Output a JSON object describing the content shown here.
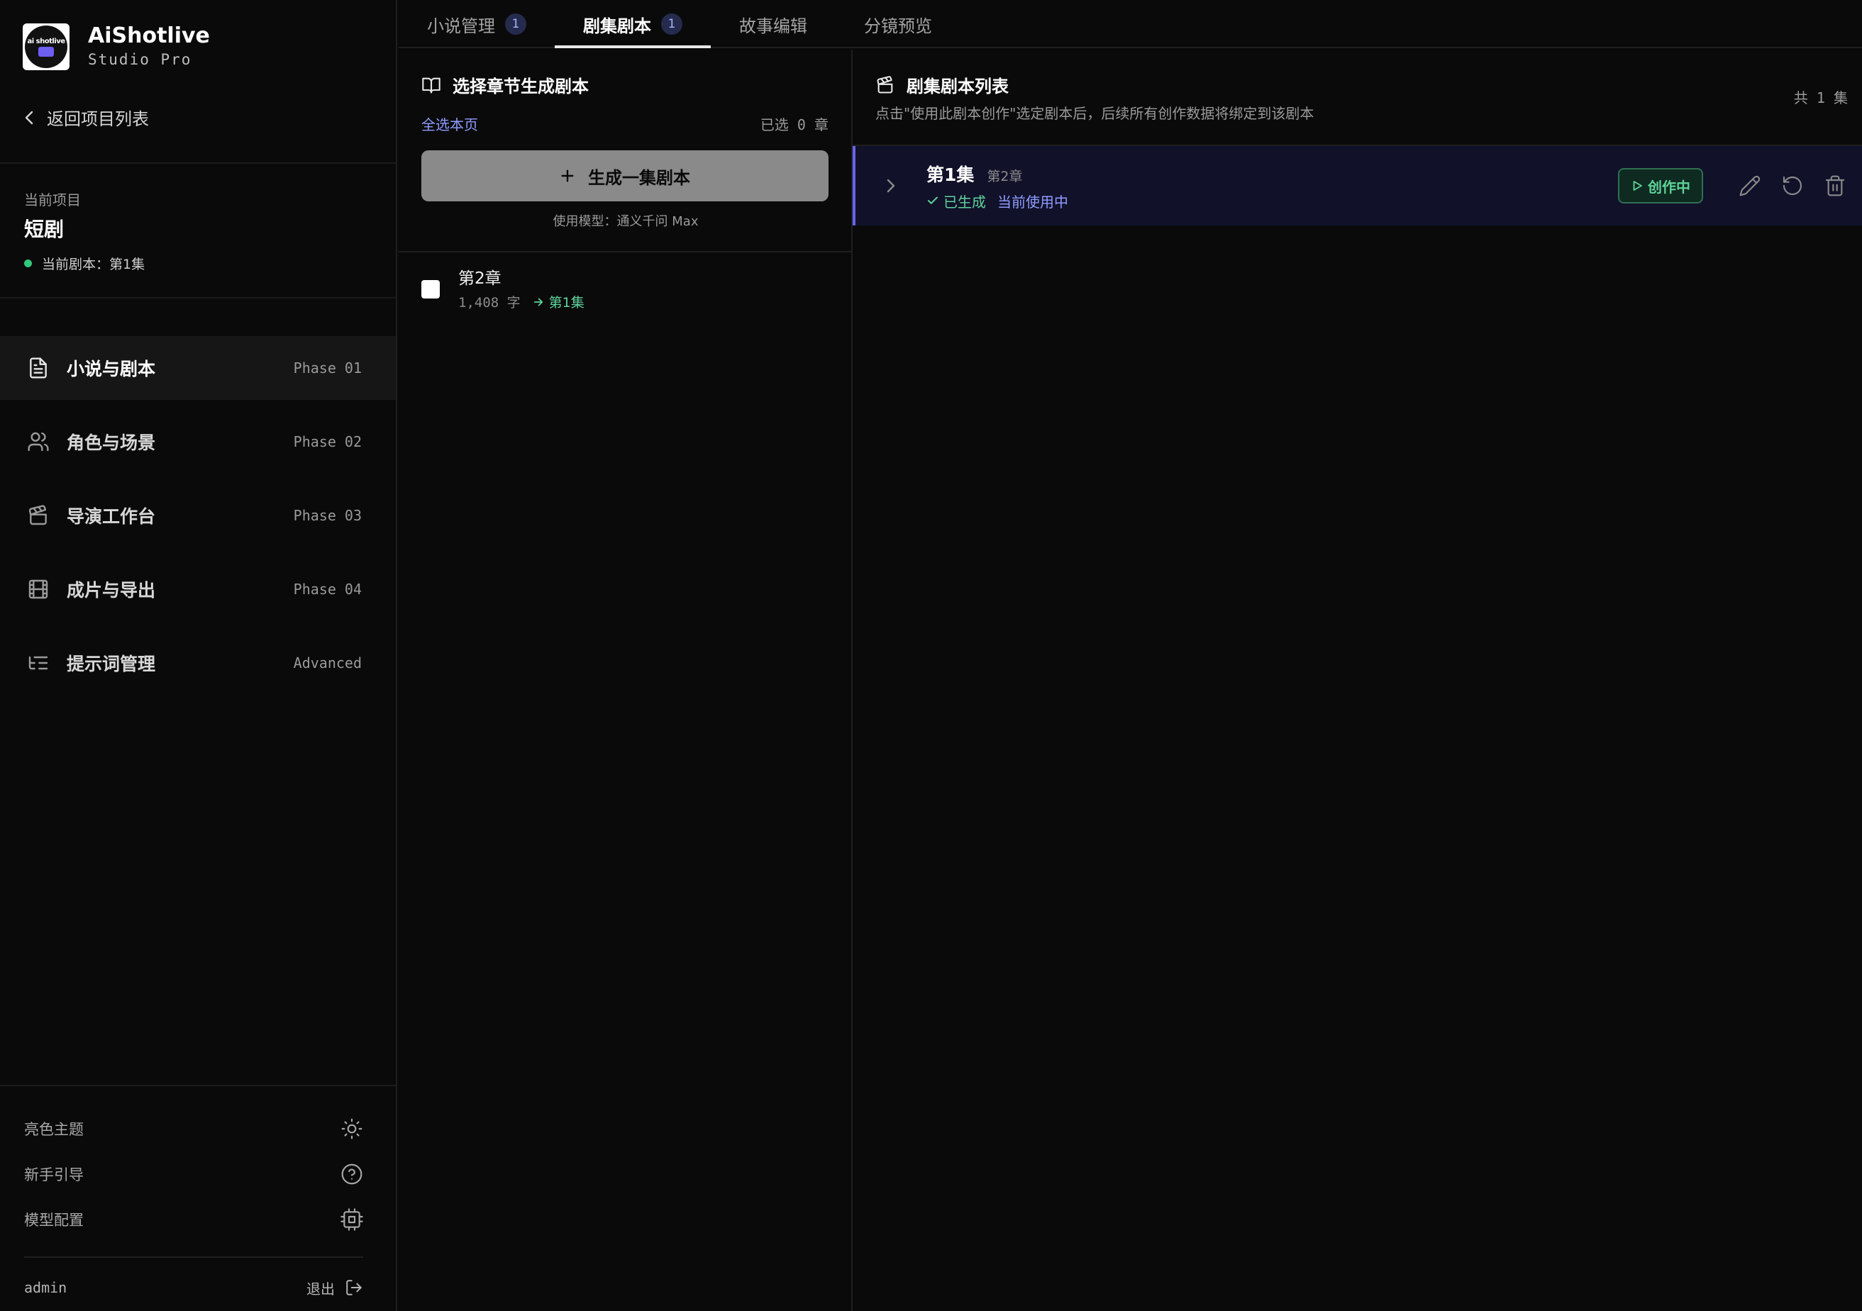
{
  "brand": {
    "name": "AiShotlive",
    "subtitle": "Studio Pro",
    "logo_text": "ai shotlive"
  },
  "sidebar": {
    "back_label": "返回项目列表",
    "project_label": "当前项目",
    "project_name": "短剧",
    "current_script": "当前剧本：第1集",
    "nav": [
      {
        "label": "小说与剧本",
        "phase": "Phase 01",
        "icon": "document-icon",
        "active": true
      },
      {
        "label": "角色与场景",
        "phase": "Phase 02",
        "icon": "users-icon",
        "active": false
      },
      {
        "label": "导演工作台",
        "phase": "Phase 03",
        "icon": "clapperboard-icon",
        "active": false
      },
      {
        "label": "成片与导出",
        "phase": "Phase 04",
        "icon": "film-icon",
        "active": false
      },
      {
        "label": "提示词管理",
        "phase": "Advanced",
        "icon": "list-tree-icon",
        "active": false
      }
    ],
    "bottom": {
      "theme_label": "亮色主题",
      "guide_label": "新手引导",
      "model_label": "模型配置",
      "user": "admin",
      "logout_label": "退出"
    }
  },
  "tabs": [
    {
      "label": "小说管理",
      "badge": "1",
      "active": false
    },
    {
      "label": "剧集剧本",
      "badge": "1",
      "active": true
    },
    {
      "label": "故事编辑",
      "badge": "",
      "active": false
    },
    {
      "label": "分镜预览",
      "badge": "",
      "active": false
    }
  ],
  "chapter_panel": {
    "title": "选择章节生成剧本",
    "select_all": "全选本页",
    "selected_count": "已选 0 章",
    "generate_button": "生成一集剧本",
    "model_hint": "使用模型：通义千问 Max",
    "chapters": [
      {
        "title": "第2章",
        "word_count": "1,408 字",
        "linked_episode": "第1集",
        "checked": false
      }
    ]
  },
  "episode_panel": {
    "title": "剧集剧本列表",
    "subtitle": "点击\"使用此剧本创作\"选定剧本后，后续所有创作数据将绑定到该剧本",
    "total": "共 1 集",
    "episodes": [
      {
        "title": "第1集",
        "chapter": "第2章",
        "status": "已生成",
        "in_use": "当前使用中",
        "action_label": "创作中"
      }
    ]
  },
  "colors": {
    "background": "#0a0a0a",
    "accent_indigo": "#6d63e8",
    "link_blue": "#8f9cff",
    "success_green": "#5fd39a",
    "status_dot": "#34c77b"
  }
}
